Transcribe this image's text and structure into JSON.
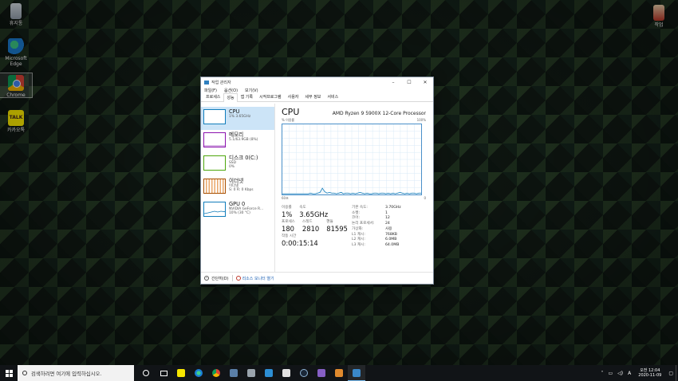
{
  "desktop": {
    "icons": [
      {
        "label": "휴지통",
        "icon": "recycle-bin-icon"
      },
      {
        "label": "Microsoft Edge",
        "icon": "edge-icon"
      },
      {
        "label": "Chrome",
        "icon": "chrome-icon"
      },
      {
        "label": "카카오톡",
        "icon": "kakaotalk-icon"
      },
      {
        "label": "작업",
        "icon": "app-file-icon"
      }
    ]
  },
  "taskmanager": {
    "title": "작업 관리자",
    "menu": [
      "파일(F)",
      "옵션(O)",
      "보기(V)"
    ],
    "tabs": [
      "프로세스",
      "성능",
      "앱 기록",
      "시작프로그램",
      "사용자",
      "세부 정보",
      "서비스"
    ],
    "active_tab": "성능",
    "sidebar": [
      {
        "name": "CPU",
        "l1": "1% 3.65GHz",
        "l2": "",
        "color": "#117dbb"
      },
      {
        "name": "메모리",
        "l1": "5.1/63.9GB (8%)",
        "l2": "",
        "color": "#8b12ae"
      },
      {
        "name": "디스크 0(C:)",
        "l1": "SSD",
        "l2": "0%",
        "color": "#4da60c"
      },
      {
        "name": "이더넷",
        "l1": "이더넷",
        "l2": "S: 0  R: 0 Kbps",
        "color": "#a74f01"
      },
      {
        "name": "GPU 0",
        "l1": "NVIDIA GeForce R...",
        "l2": "10% (30 °C)",
        "color": "#117dbb"
      }
    ],
    "cpu": {
      "heading": "CPU",
      "processor": "AMD Ryzen 9 5900X 12-Core Processor",
      "graph_label": "% 이용률",
      "graph_max": "100%",
      "graph_time": "60초",
      "graph_min": "0",
      "utilization_history": [
        1,
        1,
        1,
        1,
        1,
        1,
        1,
        1,
        1,
        1,
        1,
        1,
        2,
        1,
        1,
        2,
        3,
        9,
        4,
        2,
        3,
        2,
        2,
        1,
        2,
        3,
        1,
        2,
        2,
        1,
        2,
        1,
        2,
        3,
        2,
        1,
        2,
        1,
        1,
        2,
        2,
        1,
        2,
        2,
        1,
        2,
        1,
        2,
        1,
        2,
        3,
        2,
        1,
        2,
        1,
        2,
        2,
        1,
        2,
        2
      ],
      "stats": {
        "util_label": "이용률",
        "util_value": "1%",
        "speed_label": "속도",
        "speed_value": "3.65GHz",
        "proc_label": "프로세스",
        "proc_value": "180",
        "thread_label": "스레드",
        "thread_value": "2810",
        "handle_label": "핸들",
        "handle_value": "81595",
        "uptime_label": "작동 시간",
        "uptime_value": "0:00:15:14"
      },
      "details": [
        {
          "k": "기본 속도:",
          "v": "3.70GHz"
        },
        {
          "k": "소켓:",
          "v": "1"
        },
        {
          "k": "코어:",
          "v": "12"
        },
        {
          "k": "논리 프로세서:",
          "v": "24"
        },
        {
          "k": "가상화:",
          "v": "사용"
        },
        {
          "k": "L1 캐시:",
          "v": "768KB"
        },
        {
          "k": "L2 캐시:",
          "v": "6.0MB"
        },
        {
          "k": "L3 캐시:",
          "v": "64.0MB"
        }
      ]
    },
    "footer": {
      "less": "간단히(D)",
      "monitor": "리소스 모니터 열기"
    }
  },
  "taskbar": {
    "search_placeholder": "검색하려면 여기에 입력하십시오.",
    "ime": "A",
    "time": "오전 12:04",
    "date": "2020-11-09"
  }
}
